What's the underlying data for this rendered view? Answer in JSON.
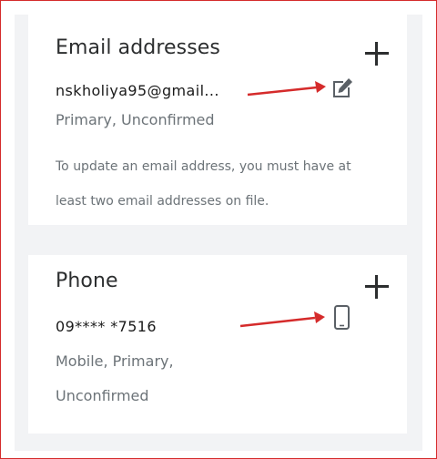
{
  "email_section": {
    "title": "Email addresses",
    "email": "nskholiya95@gmail...",
    "status": "Primary, Unconfirmed",
    "note": "To update an email address, you must have at least two email addresses on file."
  },
  "phone_section": {
    "title": "Phone",
    "number": "09**** *7516",
    "status_line1": "Mobile, Primary,",
    "status_line2": "Unconfirmed"
  },
  "colors": {
    "annotation_red": "#d52b2b",
    "icon_gray": "#5a6066",
    "panel_bg": "#f2f3f5"
  },
  "icons": {
    "add": "plus-icon",
    "edit": "edit-pencil-icon",
    "phone": "mobile-phone-icon"
  }
}
